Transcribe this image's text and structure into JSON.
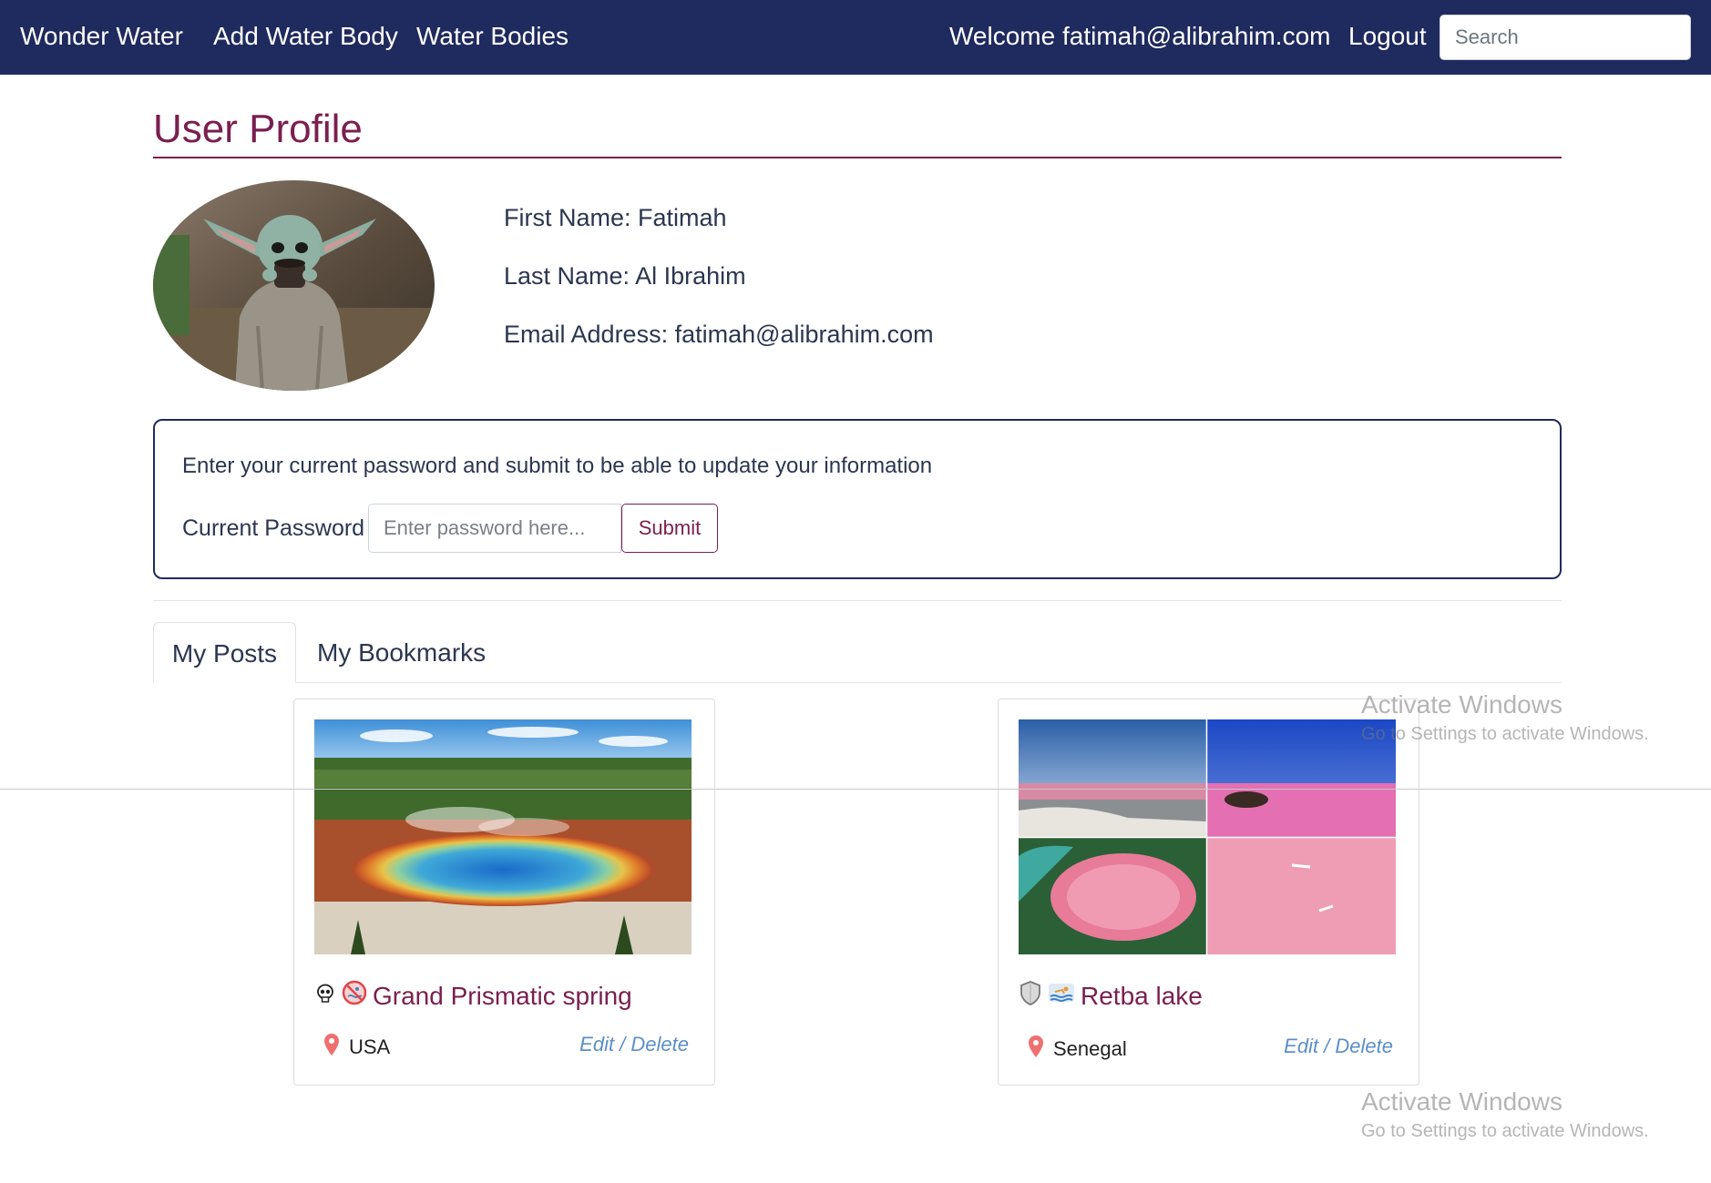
{
  "navbar": {
    "brand": "Wonder Water",
    "add_link": "Add Water Body",
    "list_link": "Water Bodies",
    "welcome": "Welcome fatimah@alibrahim.com",
    "logout": "Logout",
    "search_placeholder": "Search",
    "background": "#1f2a5e"
  },
  "profile": {
    "title": "User Profile",
    "first_name": "First Name: Fatimah",
    "last_name": "Last Name: Al Ibrahim",
    "email": "Email Address: fatimah@alibrahim.com",
    "avatar_icon": "avatar-photo"
  },
  "password_form": {
    "message": "Enter your current password and submit to be able to update your information",
    "label": "Current Password",
    "placeholder": "Enter password here...",
    "submit": "Submit"
  },
  "tabs": [
    {
      "label": "My Posts",
      "active": true
    },
    {
      "label": "My Bookmarks",
      "active": false
    }
  ],
  "posts": [
    {
      "title": "Grand Prismatic spring",
      "location": "USA",
      "actions": "Edit / Delete",
      "icons": [
        "skull-icon",
        "no-swimming-icon"
      ]
    },
    {
      "title": "Retba lake",
      "location": "Senegal",
      "actions": "Edit / Delete",
      "icons": [
        "shield-icon",
        "swimming-icon"
      ]
    }
  ],
  "watermark": {
    "title": "Activate Windows",
    "subtitle": "Go to Settings to activate Windows."
  },
  "colors": {
    "accent": "#7a1f4f",
    "link": "#5b8fc8",
    "nav": "#1f2a5e"
  }
}
